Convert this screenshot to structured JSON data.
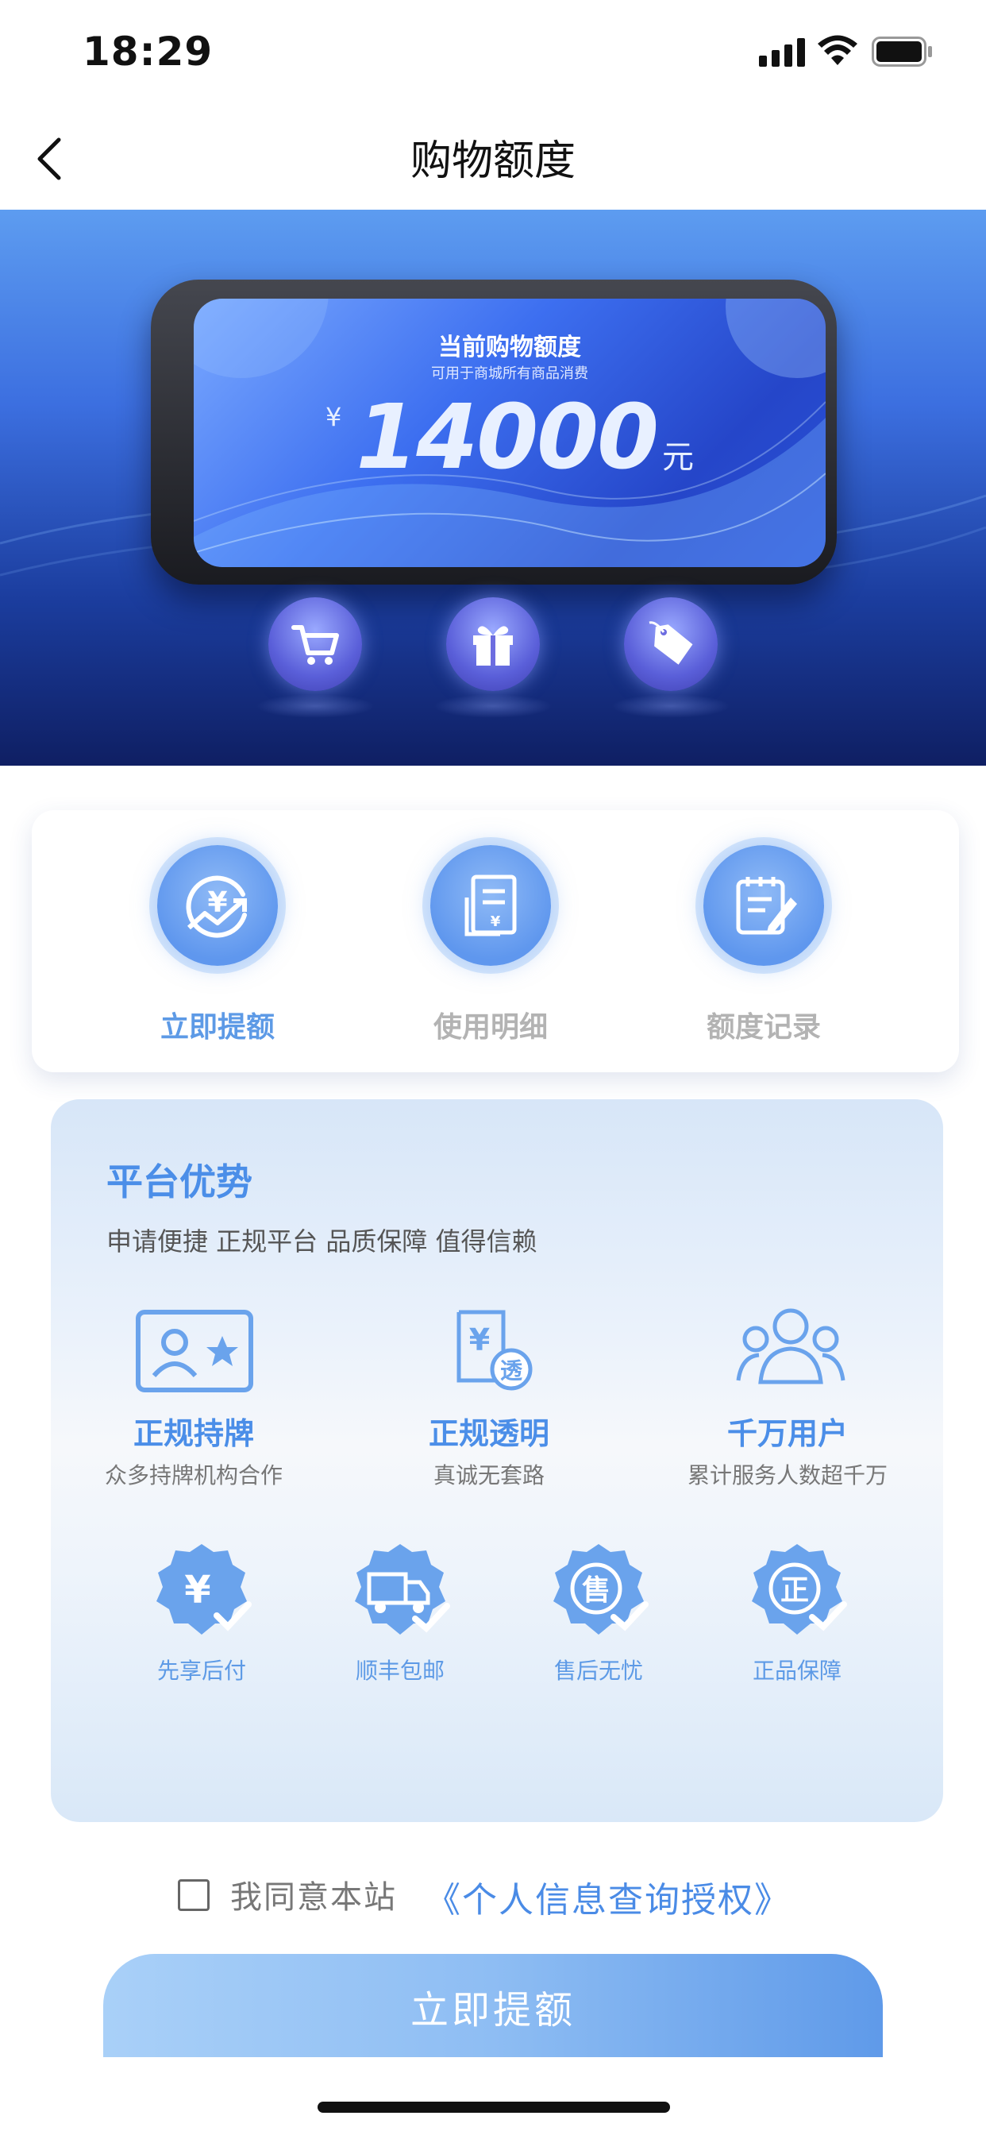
{
  "status_bar": {
    "time": "18:29"
  },
  "nav": {
    "title": "购物额度"
  },
  "banner": {
    "card_title": "当前购物额度",
    "card_subtitle": "可用于商城所有商品消费",
    "currency_symbol": "¥",
    "amount": "14000",
    "unit": "元",
    "icons": [
      "cart-icon",
      "gift-icon",
      "tag-icon"
    ]
  },
  "actions": [
    {
      "label": "立即提额",
      "icon": "raise-limit-icon",
      "active": true
    },
    {
      "label": "使用明细",
      "icon": "usage-detail-icon",
      "active": false
    },
    {
      "label": "额度记录",
      "icon": "limit-record-icon",
      "active": false
    }
  ],
  "advantages": {
    "title": "平台优势",
    "subtitle": "申请便捷 正规平台 品质保障 值得信赖",
    "features": [
      {
        "title": "正规持牌",
        "desc": "众多持牌机构合作",
        "icon": "license-icon"
      },
      {
        "title": "正规透明",
        "desc": "真诚无套路",
        "icon": "transparent-icon"
      },
      {
        "title": "千万用户",
        "desc": "累计服务人数超千万",
        "icon": "users-icon"
      }
    ],
    "badges": [
      {
        "label": "先享后付",
        "icon": "yuan-badge-icon",
        "glyph": "¥"
      },
      {
        "label": "顺丰包邮",
        "icon": "delivery-truck-badge-icon",
        "glyph": ""
      },
      {
        "label": "售后无忧",
        "icon": "after-sales-badge-icon",
        "glyph": "售"
      },
      {
        "label": "正品保障",
        "icon": "genuine-badge-icon",
        "glyph": "正"
      }
    ]
  },
  "agreement": {
    "prefix": "我同意本站",
    "link": "《个人信息查询授权》",
    "checked": false
  },
  "submit": {
    "label": "立即提额"
  },
  "colors": {
    "accent": "#4b8ee8",
    "banner_dark": "#0f1f63",
    "inactive": "#b3b3b3"
  }
}
